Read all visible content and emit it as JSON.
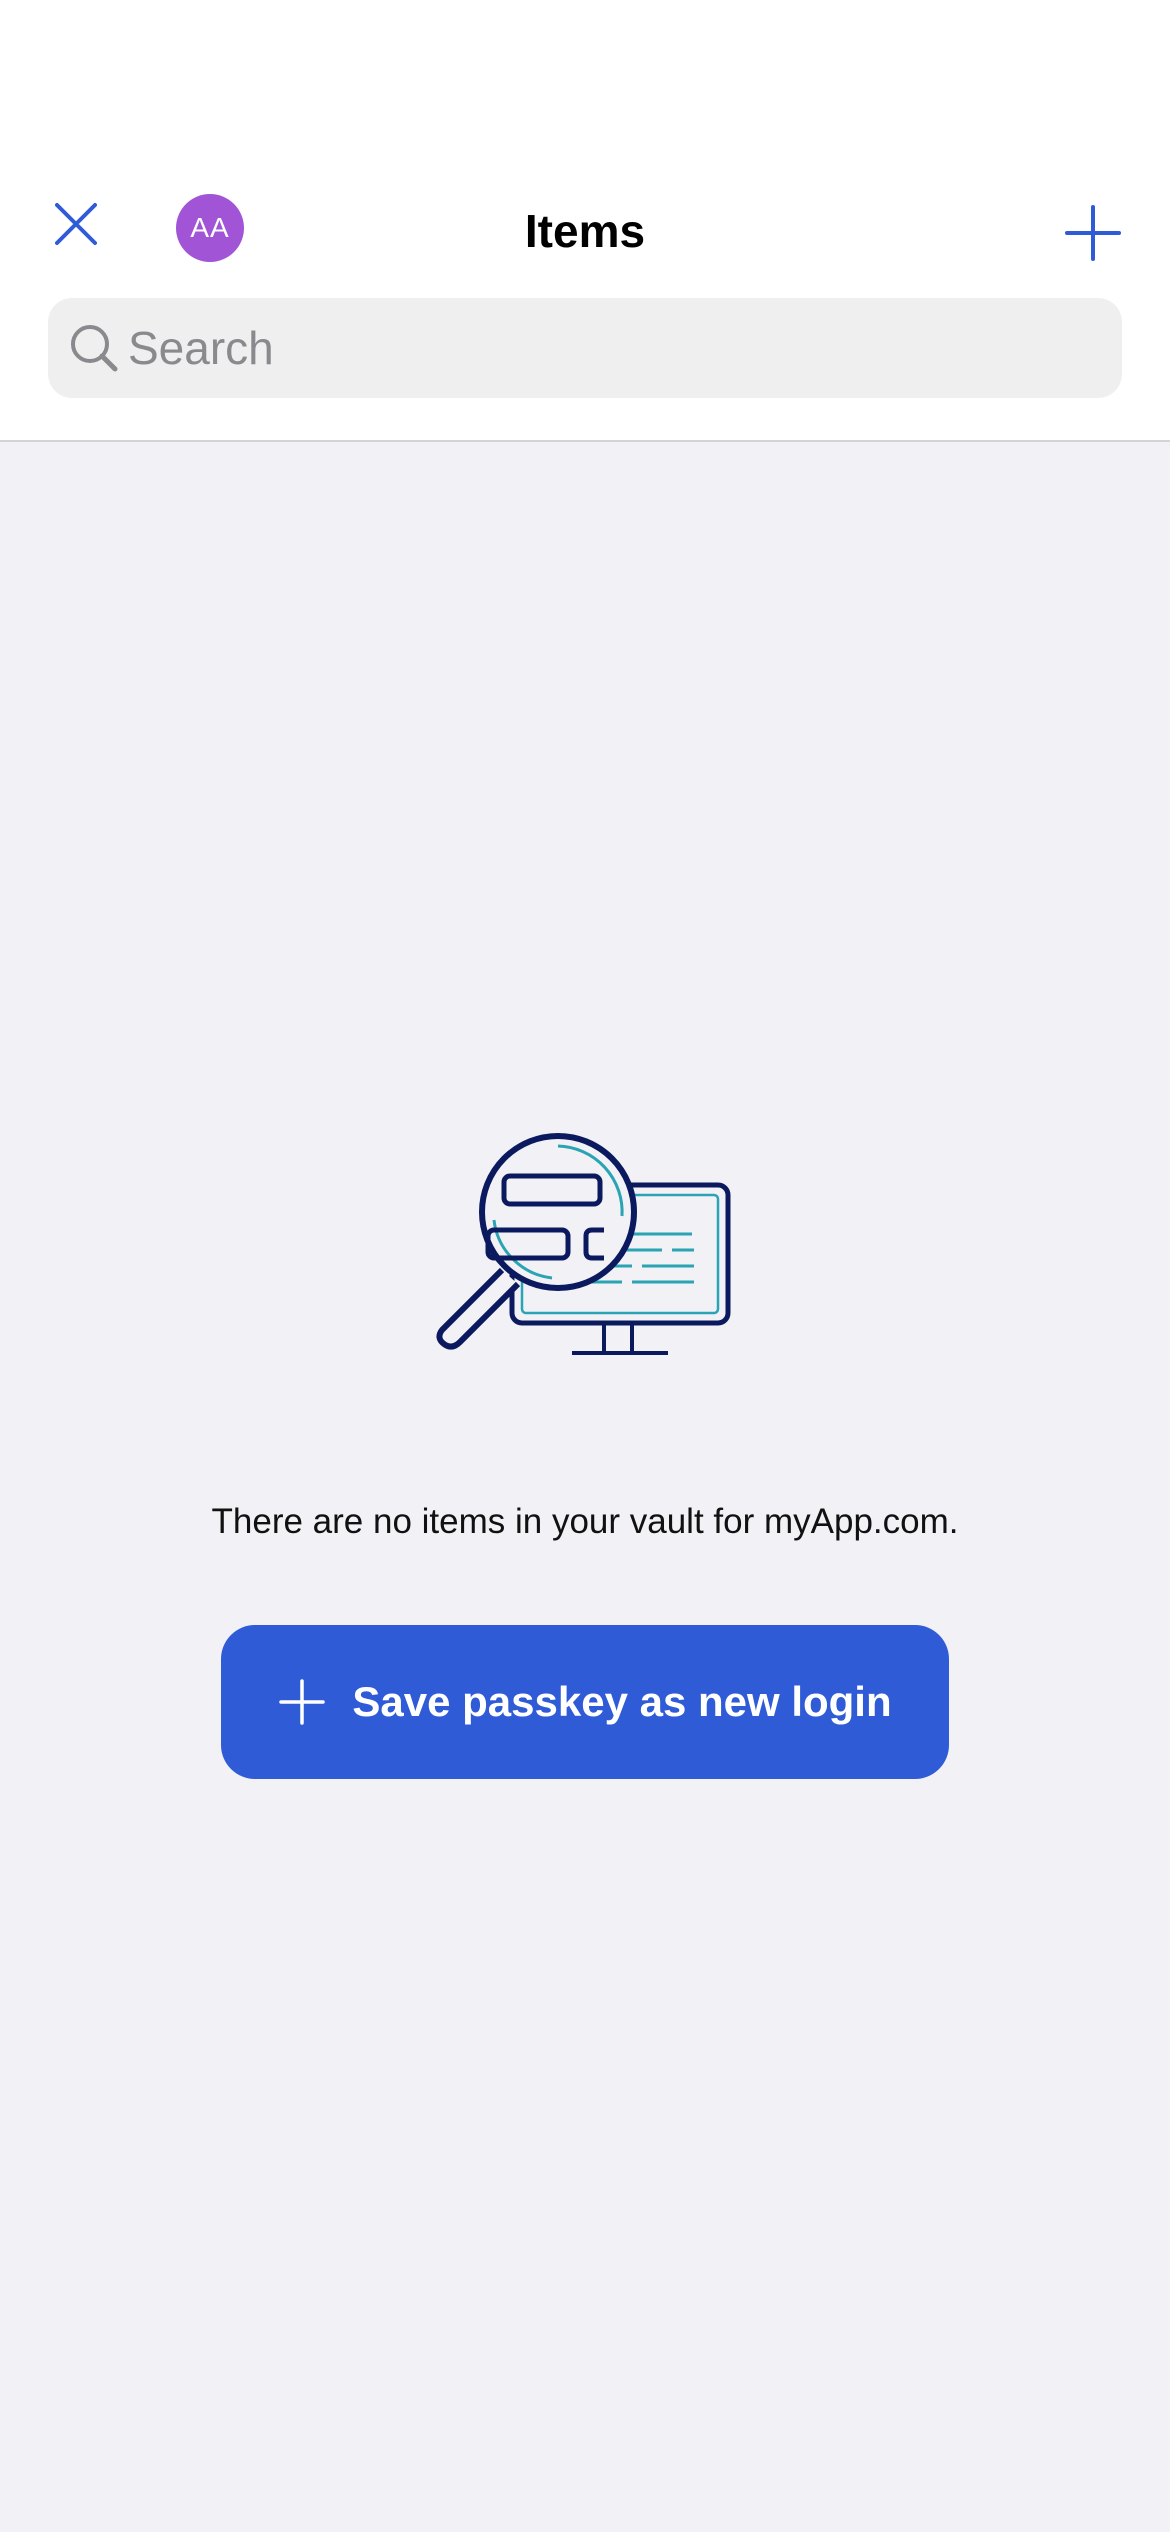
{
  "header": {
    "title": "Items",
    "avatar_initials": "AA",
    "close_icon": "close-icon",
    "add_icon": "plus-icon"
  },
  "search": {
    "placeholder": "Search",
    "value": "",
    "icon": "search-icon"
  },
  "empty_state": {
    "illustration": "magnifier-over-monitor-illustration",
    "message": "There are no items in your vault for myApp.com.",
    "button_label": "Save passkey as new login",
    "button_icon": "plus-icon"
  },
  "colors": {
    "accent": "#2f5bd6",
    "avatar": "#a155d6",
    "background": "#f1f1f6",
    "header_bg": "#ffffff",
    "illustration_navy": "#0b1a5e",
    "illustration_teal": "#2aa4b4"
  }
}
